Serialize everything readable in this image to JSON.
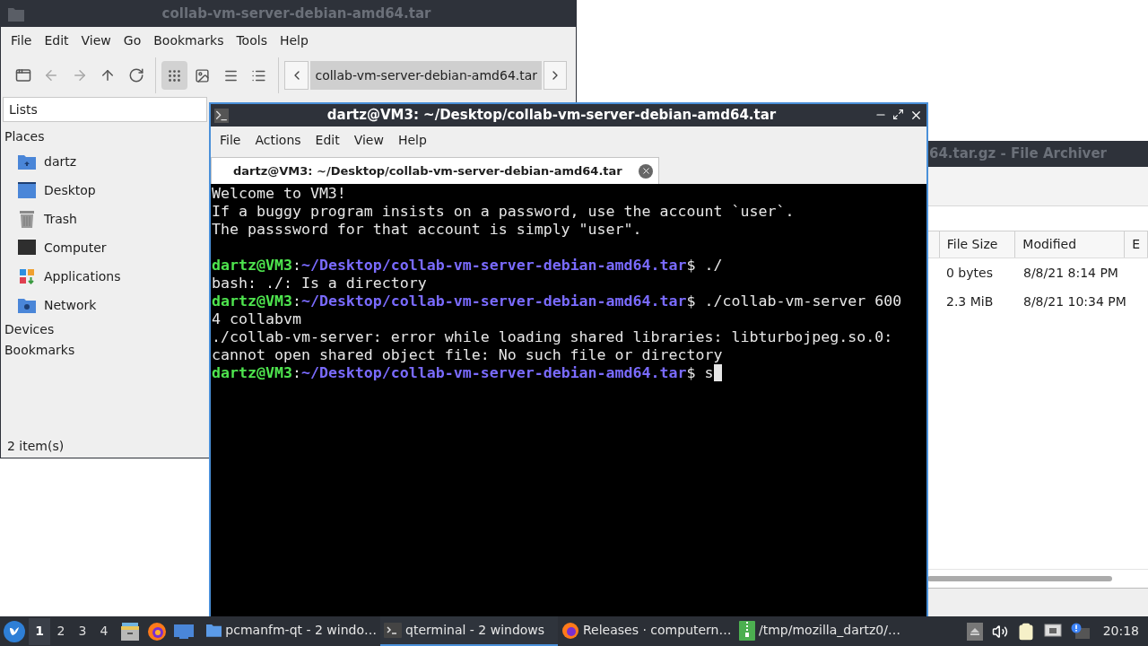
{
  "file_manager": {
    "title": "collab-vm-server-debian-amd64.tar",
    "menu": [
      "File",
      "Edit",
      "View",
      "Go",
      "Bookmarks",
      "Tools",
      "Help"
    ],
    "toolbar": [
      {
        "kind": "new-tab",
        "disabled": false
      },
      {
        "kind": "back",
        "disabled": true
      },
      {
        "kind": "forward",
        "disabled": true
      },
      {
        "kind": "up",
        "disabled": false
      },
      {
        "kind": "reload",
        "disabled": false
      }
    ],
    "view_modes": [
      {
        "kind": "icons",
        "selected": true
      },
      {
        "kind": "thumbnails",
        "selected": false
      },
      {
        "kind": "compact",
        "selected": false
      },
      {
        "kind": "details",
        "selected": false
      }
    ],
    "path": [
      {
        "label": "collab-vm-server-debian-amd64.tar",
        "selected": true
      }
    ],
    "sidebar": {
      "mode": "Lists",
      "sections": [
        {
          "title": "Places",
          "items": [
            {
              "label": "dartz",
              "kind": "home"
            },
            {
              "label": "Desktop",
              "kind": "desktop"
            },
            {
              "label": "Trash",
              "kind": "trash"
            },
            {
              "label": "Computer",
              "kind": "computer"
            },
            {
              "label": "Applications",
              "kind": "applications"
            },
            {
              "label": "Network",
              "kind": "network"
            }
          ]
        },
        {
          "title": "Devices"
        },
        {
          "title": "Bookmarks"
        }
      ]
    },
    "status": "2 item(s)"
  },
  "archiver": {
    "title": "64.tar.gz - File Archiver",
    "columns": [
      "File Size",
      "Modified",
      "E"
    ],
    "rows": [
      [
        "0 bytes",
        "8/8/21 8:14 PM"
      ],
      [
        "2.3 MiB",
        "8/8/21 10:34 PM"
      ]
    ]
  },
  "terminal": {
    "title": "dartz@VM3: ~/Desktop/collab-vm-server-debian-amd64.tar",
    "menu": [
      "File",
      "Actions",
      "Edit",
      "View",
      "Help"
    ],
    "tabs": [
      {
        "label": "dartz@VM3: ~/Desktop/collab-vm-server-debian-amd64.tar",
        "selected": true
      }
    ],
    "lines": [
      {
        "kind": "text",
        "text": "Welcome to VM3!"
      },
      {
        "kind": "text",
        "text": "If a buggy program insists on a password, use the account `user`."
      },
      {
        "kind": "text",
        "text": "The passsword for that account is simply \"user\"."
      },
      {
        "kind": "blank"
      },
      {
        "kind": "prompt",
        "user": "dartz@VM3",
        "sep": ":",
        "path": "~/Desktop/collab-vm-server-debian-amd64.tar",
        "command": "$ ./"
      },
      {
        "kind": "text",
        "text": "bash: ./: Is a directory"
      },
      {
        "kind": "prompt",
        "user": "dartz@VM3",
        "sep": ":",
        "path": "~/Desktop/collab-vm-server-debian-amd64.tar",
        "command": "$ ./collab-vm-server 600"
      },
      {
        "kind": "text",
        "text": "4 collabvm"
      },
      {
        "kind": "text",
        "text": "./collab-vm-server: error while loading shared libraries: libturbojpeg.so.0:"
      },
      {
        "kind": "text",
        "text": "cannot open shared object file: No such file or directory"
      },
      {
        "kind": "prompt",
        "user": "dartz@VM3",
        "sep": ":",
        "path": "~/Desktop/collab-vm-server-debian-amd64.tar",
        "command": "$ s",
        "cursor": true
      }
    ]
  },
  "taskbar": {
    "workspaces": [
      {
        "label": "1",
        "selected": true
      },
      {
        "label": "2",
        "selected": false
      },
      {
        "label": "3",
        "selected": false
      },
      {
        "label": "4",
        "selected": false
      }
    ],
    "launchers": [
      {
        "kind": "files"
      },
      {
        "kind": "browser"
      },
      {
        "kind": "desktop"
      }
    ],
    "tasks": [
      {
        "label": "pcmanfm-qt - 2 windo…",
        "kind": "folder",
        "selected": false
      },
      {
        "label": "qterminal - 2 windows",
        "kind": "terminal",
        "selected": true
      },
      {
        "label": "Releases · computern…",
        "kind": "browser",
        "selected": false
      },
      {
        "label": "/tmp/mozilla_dartz0/…",
        "kind": "archive",
        "selected": false
      }
    ],
    "tray": [
      {
        "kind": "eject"
      },
      {
        "kind": "volume"
      },
      {
        "kind": "clipboard"
      },
      {
        "kind": "network"
      },
      {
        "kind": "notification"
      }
    ],
    "clock": "20:18"
  }
}
